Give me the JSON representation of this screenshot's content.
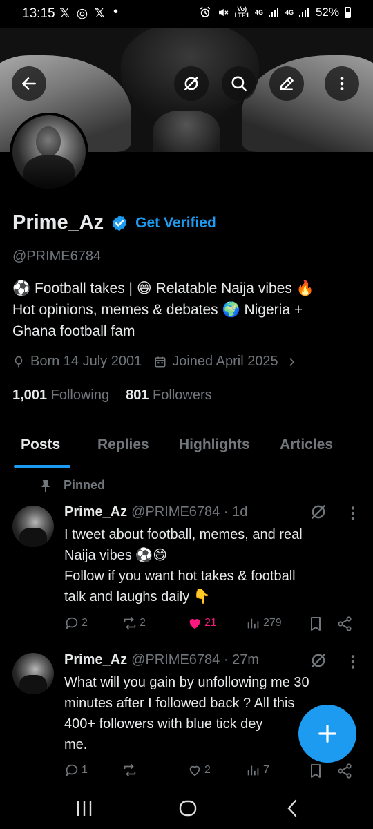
{
  "status_bar": {
    "time": "13:15",
    "apps": "𝕏 ◎ 𝕏",
    "dot": "•",
    "net_top": "Vo)",
    "net_bottom": "LTE1",
    "sig1": "4G",
    "sig2": "4G",
    "battery": "52%"
  },
  "profile": {
    "display_name": "Prime_Az",
    "get_verified": "Get Verified",
    "handle": "@PRIME6784",
    "bio_line1": "⚽ Football takes | 😄 Relatable Naija vibes 🔥",
    "bio_line2": "Hot opinions, memes & debates 🌍 Nigeria +",
    "bio_line3": "Ghana football fam",
    "born": "Born 14 July 2001",
    "joined": "Joined April 2025",
    "following_count": "1,001",
    "following_label": "Following",
    "followers_count": "801",
    "followers_label": "Followers"
  },
  "tabs": [
    "Posts",
    "Replies",
    "Highlights",
    "Articles"
  ],
  "pinned_label": "Pinned",
  "posts": [
    {
      "name": "Prime_Az",
      "handle_time": "@PRIME6784 · 1d",
      "body_lines": [
        "I tweet about football, memes, and real",
        "Naija vibes ⚽😄",
        "Follow if you want hot takes & football",
        "talk and  laughs daily 👇"
      ],
      "replies": "2",
      "reposts": "2",
      "likes": "21",
      "views": "279"
    },
    {
      "name": "Prime_Az",
      "handle_time": "@PRIME6784 · 27m",
      "body_lines": [
        "What will you gain by unfollowing me 30",
        "minutes after I followed back ? All this",
        "400+ followers with blue tick dey",
        "me."
      ],
      "replies": "1",
      "reposts": "",
      "likes": "2",
      "views": "7"
    }
  ],
  "colors": {
    "accent": "#1d9bf0",
    "like": "#f91880",
    "muted": "#71767b",
    "text": "#e7e9ea",
    "background": "#000000",
    "divider": "#2f3336"
  }
}
